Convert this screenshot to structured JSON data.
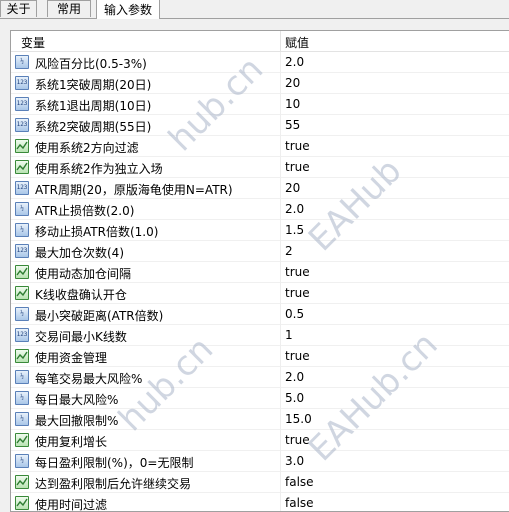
{
  "tabs": [
    {
      "label": "关于",
      "active": false
    },
    {
      "label": "常用",
      "active": false
    },
    {
      "label": "输入参数",
      "active": true
    }
  ],
  "table": {
    "columns": [
      "变量",
      "赋值"
    ],
    "rows": [
      {
        "icon": "double-icon",
        "icon_text": "½",
        "name": "风险百分比(0.5-3%)",
        "value": "2.0"
      },
      {
        "icon": "integer-icon",
        "icon_text": "123",
        "name": "系统1突破周期(20日)",
        "value": "20"
      },
      {
        "icon": "integer-icon",
        "icon_text": "123",
        "name": "系统1退出周期(10日)",
        "value": "10"
      },
      {
        "icon": "integer-icon",
        "icon_text": "123",
        "name": "系统2突破周期(55日)",
        "value": "55"
      },
      {
        "icon": "boolean-icon",
        "icon_text": "",
        "name": "使用系统2方向过滤",
        "value": "true"
      },
      {
        "icon": "boolean-icon",
        "icon_text": "",
        "name": "使用系统2作为独立入场",
        "value": "true"
      },
      {
        "icon": "integer-icon",
        "icon_text": "123",
        "name": "ATR周期(20，原版海龟使用N=ATR)",
        "value": "20"
      },
      {
        "icon": "double-icon",
        "icon_text": "½",
        "name": "ATR止损倍数(2.0)",
        "value": "2.0"
      },
      {
        "icon": "double-icon",
        "icon_text": "½",
        "name": "移动止损ATR倍数(1.0)",
        "value": "1.5"
      },
      {
        "icon": "integer-icon",
        "icon_text": "123",
        "name": "最大加仓次数(4)",
        "value": "2"
      },
      {
        "icon": "boolean-icon",
        "icon_text": "",
        "name": "使用动态加仓间隔",
        "value": "true"
      },
      {
        "icon": "boolean-icon",
        "icon_text": "",
        "name": "K线收盘确认开仓",
        "value": "true"
      },
      {
        "icon": "double-icon",
        "icon_text": "½",
        "name": "最小突破距离(ATR倍数)",
        "value": "0.5"
      },
      {
        "icon": "integer-icon",
        "icon_text": "123",
        "name": "交易间最小K线数",
        "value": "1"
      },
      {
        "icon": "boolean-icon",
        "icon_text": "",
        "name": "使用资金管理",
        "value": "true"
      },
      {
        "icon": "double-icon",
        "icon_text": "½",
        "name": "每笔交易最大风险%",
        "value": "2.0"
      },
      {
        "icon": "double-icon",
        "icon_text": "½",
        "name": "每日最大风险%",
        "value": "5.0"
      },
      {
        "icon": "double-icon",
        "icon_text": "½",
        "name": "最大回撤限制%",
        "value": "15.0"
      },
      {
        "icon": "boolean-icon",
        "icon_text": "",
        "name": "使用复利增长",
        "value": "true"
      },
      {
        "icon": "double-icon",
        "icon_text": "½",
        "name": "每日盈利限制(%)，0=无限制",
        "value": "3.0"
      },
      {
        "icon": "boolean-icon",
        "icon_text": "",
        "name": "达到盈利限制后允许继续交易",
        "value": "false"
      },
      {
        "icon": "boolean-icon",
        "icon_text": "",
        "name": "使用时间过滤",
        "value": "false"
      }
    ]
  },
  "watermarks": [
    "hub.cn",
    "EAHub",
    "EAHub.cn",
    "hub.cn",
    "EAHub.cn"
  ]
}
